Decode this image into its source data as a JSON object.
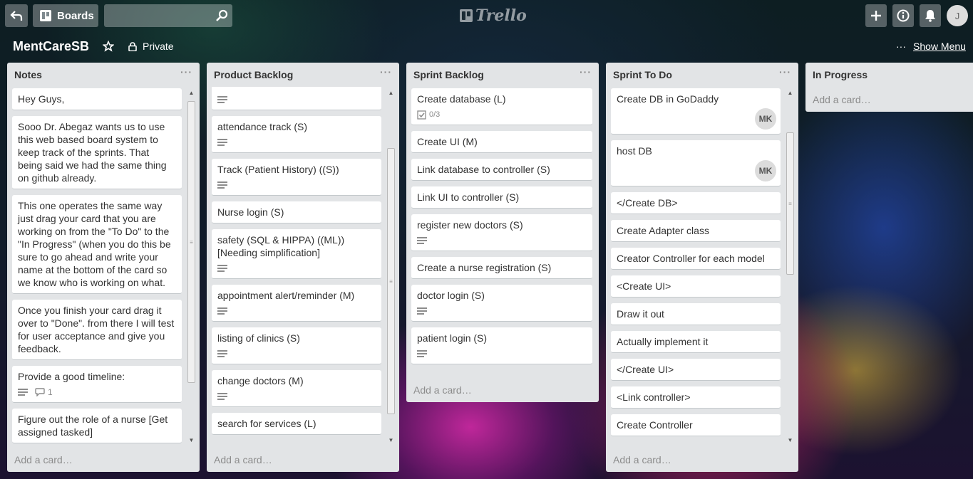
{
  "header": {
    "boards_label": "Boards",
    "search_placeholder": "",
    "logo_text": "Trello",
    "user_initial": "J"
  },
  "board": {
    "title": "MentCareSB",
    "visibility": "Private",
    "show_menu_dots": "···",
    "show_menu_label": "Show Menu"
  },
  "lists": {
    "notes": {
      "title": "Notes",
      "add_card": "Add a card…",
      "cards": [
        {
          "text": "Hey Guys,"
        },
        {
          "text": "Sooo Dr. Abegaz wants us to use this web based board system to keep track of the sprints. That being said we had the same thing on github already."
        },
        {
          "text": "This one operates the same way just drag your card that you are working on from the \"To Do\" to the \"In Progress\" (when you do this be sure to go ahead and write your name at the bottom of the card so we know who is working on what."
        },
        {
          "text": "Once you finish your card drag it over to \"Done\". from there I will test for user acceptance and give you feedback."
        },
        {
          "text": "Provide a good timeline:",
          "comments": "1"
        },
        {
          "text": "Figure out the role of a nurse [Get assigned tasked]"
        }
      ]
    },
    "product_backlog": {
      "title": "Product Backlog",
      "add_card": "Add a card…",
      "cards": [
        {
          "text": ""
        },
        {
          "text": "attendance track (S)"
        },
        {
          "text": "Track (Patient History) ((S))"
        },
        {
          "text": "Nurse login (S)"
        },
        {
          "text": "safety (SQL & HIPPA) ((ML)) [Needing simplification]"
        },
        {
          "text": "appointment alert/reminder (M)"
        },
        {
          "text": "listing of clinics (S)"
        },
        {
          "text": "change doctors (M)"
        },
        {
          "text": "search for services (L)"
        }
      ]
    },
    "sprint_backlog": {
      "title": "Sprint Backlog",
      "add_card": "Add a card…",
      "cards": [
        {
          "text": "Create database (L)",
          "checklist": "0/3"
        },
        {
          "text": "Create UI (M)"
        },
        {
          "text": "Link database to controller (S)"
        },
        {
          "text": "Link UI to controller (S)"
        },
        {
          "text": "register new doctors (S)"
        },
        {
          "text": "Create a nurse registration (S)"
        },
        {
          "text": "doctor login (S)"
        },
        {
          "text": "patient login (S)"
        }
      ]
    },
    "sprint_todo": {
      "title": "Sprint To Do",
      "add_card": "Add a card…",
      "cards": [
        {
          "text": "Create DB in GoDaddy",
          "member": "MK"
        },
        {
          "text": "host DB",
          "member": "MK"
        },
        {
          "text": "</Create DB>"
        },
        {
          "text": "Create Adapter class"
        },
        {
          "text": "Creator Controller for each model"
        },
        {
          "text": "<Create UI>"
        },
        {
          "text": "Draw it out"
        },
        {
          "text": "Actually implement it"
        },
        {
          "text": "</Create UI>"
        },
        {
          "text": "<Link controller>"
        },
        {
          "text": "Create Controller"
        }
      ]
    },
    "in_progress": {
      "title": "In Progress",
      "add_card": "Add a card…"
    }
  }
}
